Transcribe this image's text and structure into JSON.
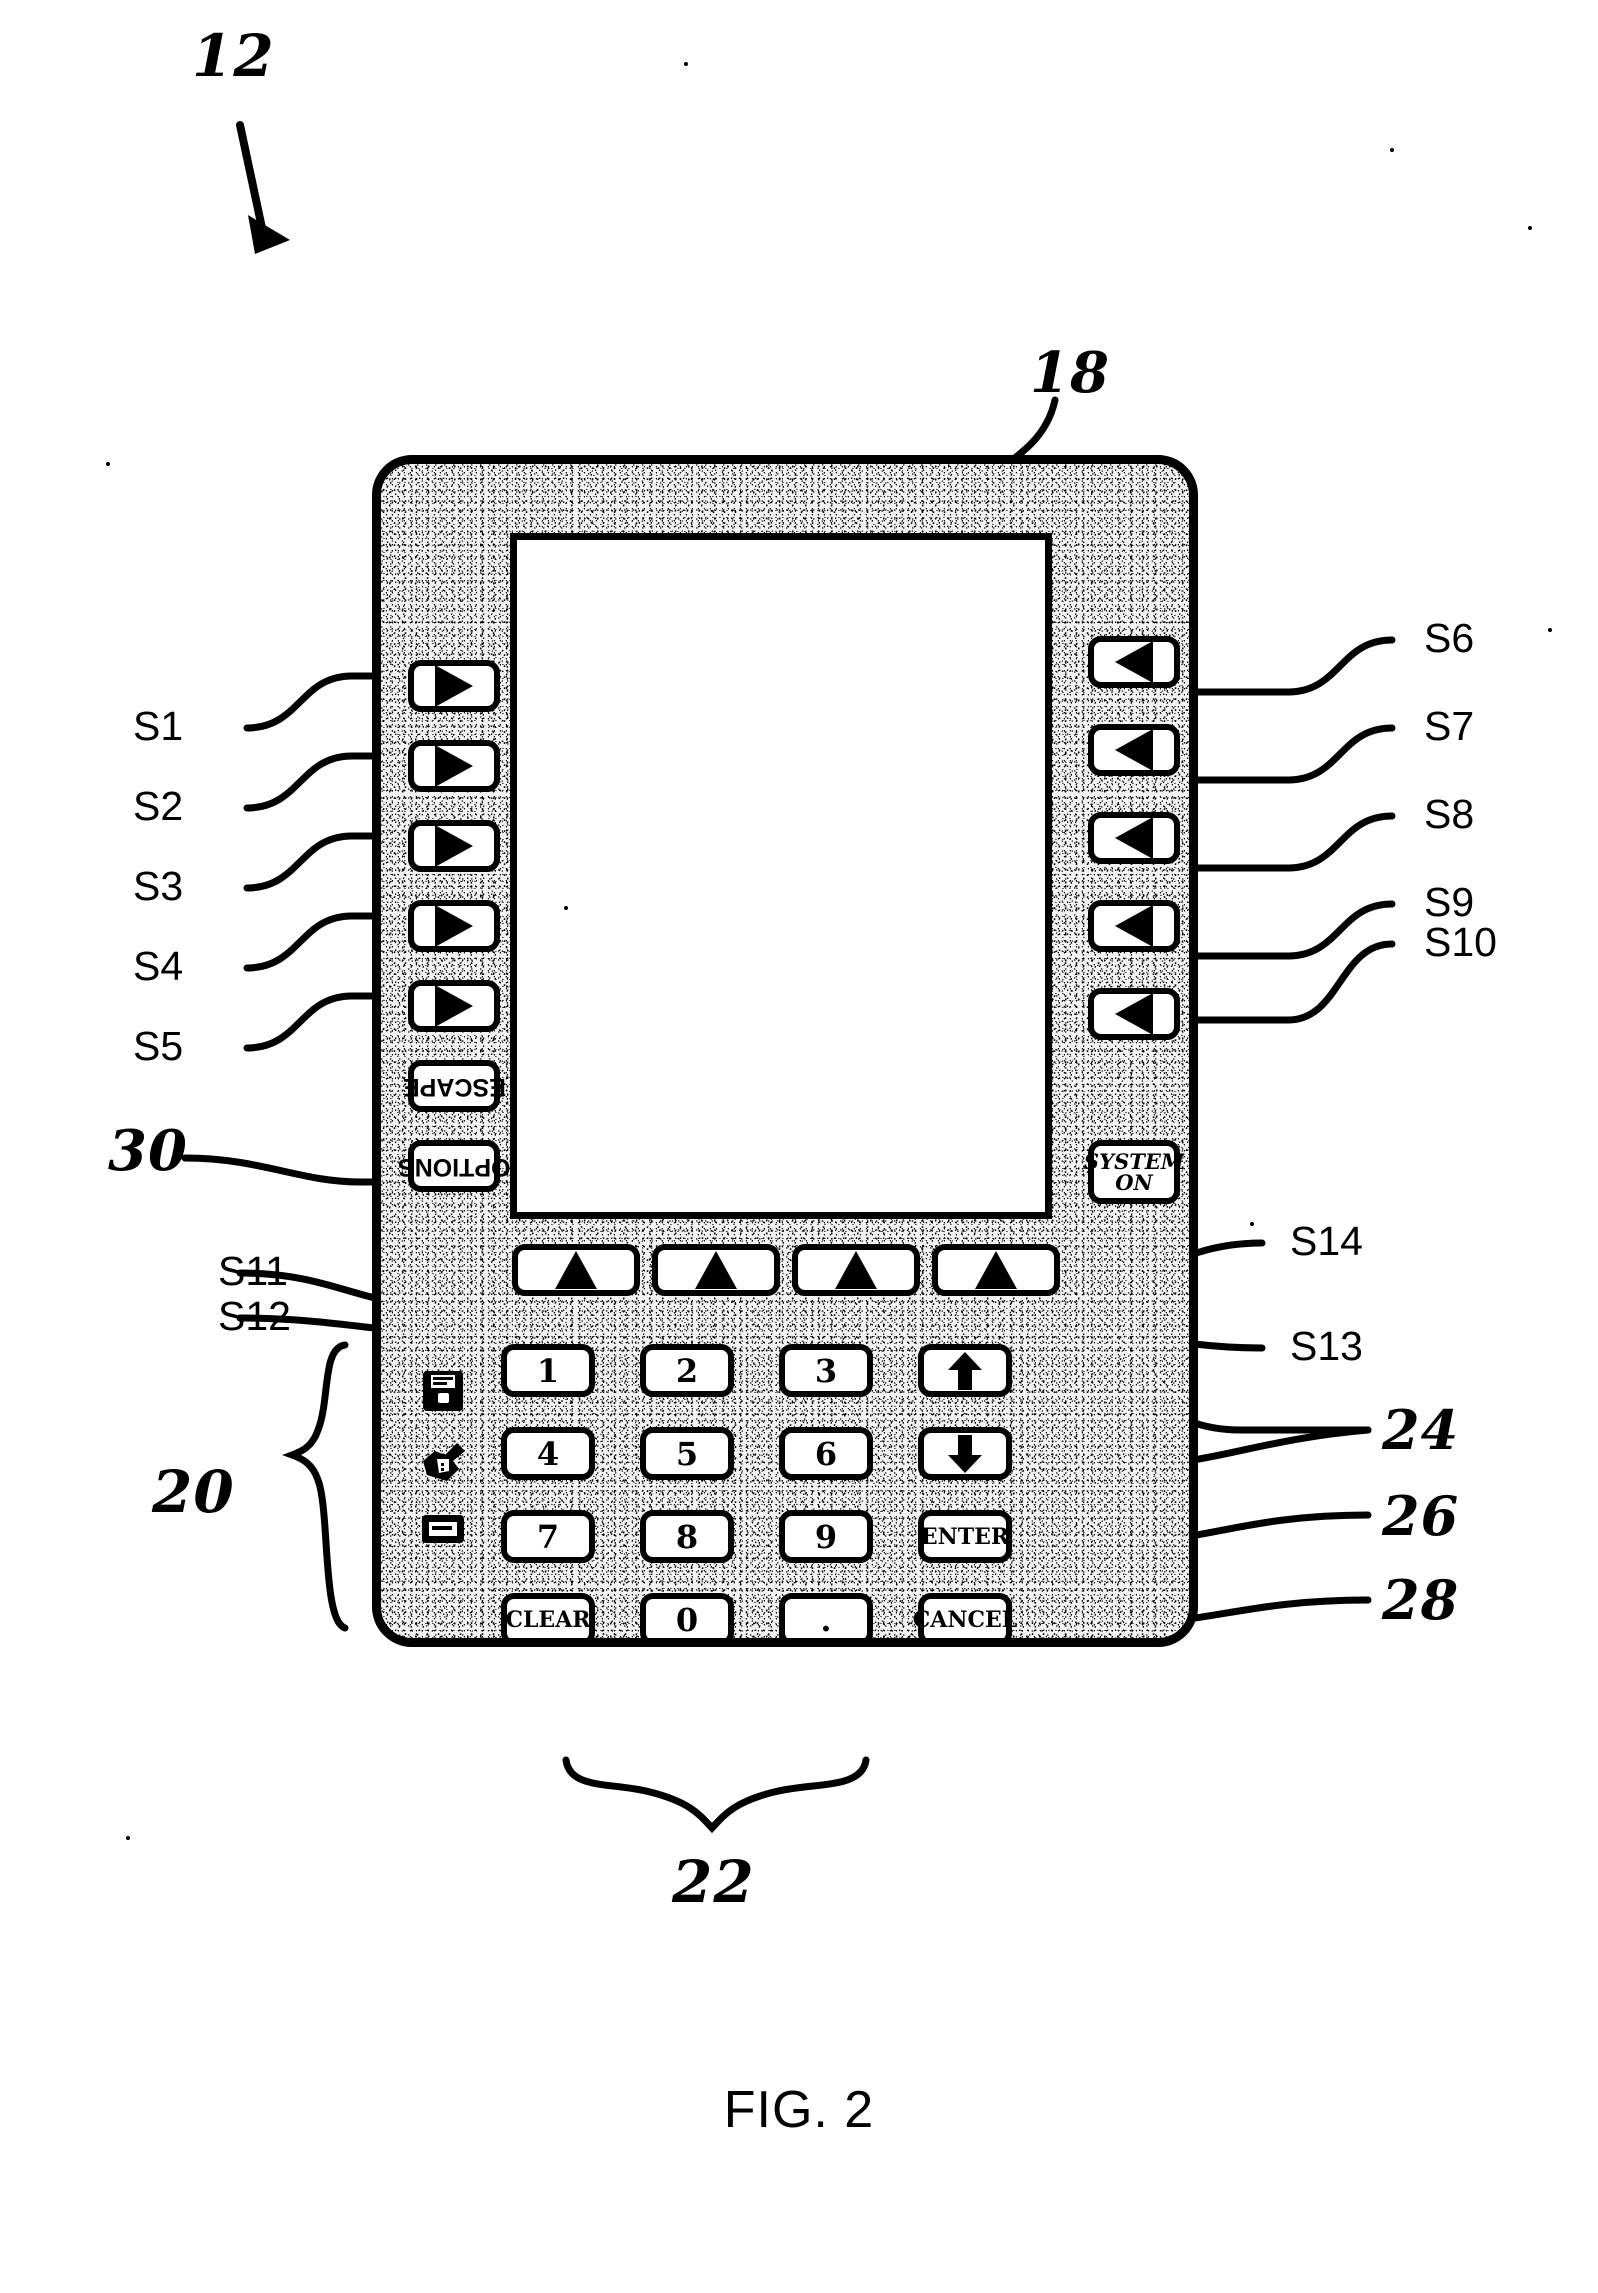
{
  "figure": {
    "caption": "FIG. 2",
    "device_ref": "12",
    "screen_ref": "18",
    "options_ref": "30",
    "icon_column_ref": "20",
    "keypad_ref": "22",
    "updown_ref": "24",
    "enter_ref": "26",
    "cancel_ref": "28"
  },
  "soft_keys": {
    "left": [
      {
        "id": "S1",
        "icon": "triangle-right-icon"
      },
      {
        "id": "S2",
        "icon": "triangle-right-icon"
      },
      {
        "id": "S3",
        "icon": "triangle-right-icon"
      },
      {
        "id": "S4",
        "icon": "triangle-right-icon"
      },
      {
        "id": "S5",
        "icon": "triangle-right-icon"
      }
    ],
    "right": [
      {
        "id": "S6",
        "icon": "triangle-left-icon"
      },
      {
        "id": "S7",
        "icon": "triangle-left-icon"
      },
      {
        "id": "S8",
        "icon": "triangle-left-icon"
      },
      {
        "id": "S9",
        "icon": "triangle-left-icon"
      },
      {
        "id": "S10",
        "icon": "triangle-left-icon"
      }
    ],
    "bottom": [
      {
        "id": "S11",
        "icon": "triangle-up-icon"
      },
      {
        "id": "S12",
        "icon": "triangle-up-icon"
      },
      {
        "id": "S13",
        "icon": "triangle-up-icon"
      },
      {
        "id": "S14",
        "icon": "triangle-up-icon"
      }
    ]
  },
  "function_keys": {
    "escape_label": "ESCAPE",
    "options_label": "OPTIONS",
    "system_on_line1": "SYSTEM",
    "system_on_line2": "ON"
  },
  "keypad": {
    "rows": [
      [
        "1",
        "2",
        "3"
      ],
      [
        "4",
        "5",
        "6"
      ],
      [
        "7",
        "8",
        "9"
      ],
      [
        "CLEAR",
        "0",
        "."
      ]
    ],
    "side_column": [
      "up-down-arrow",
      "up-down-arrow",
      "ENTER",
      "CANCEL"
    ],
    "enter_label": "ENTER",
    "cancel_label": "CANCEL",
    "clear_label": "CLEAR"
  },
  "pictograms": [
    {
      "name": "save-disk-icon"
    },
    {
      "name": "wrench-tool-icon"
    },
    {
      "name": "display-rectangle-icon"
    }
  ],
  "colors": {
    "ink": "#000000",
    "paper": "#ffffff",
    "bezel": "#f2f2f2"
  }
}
